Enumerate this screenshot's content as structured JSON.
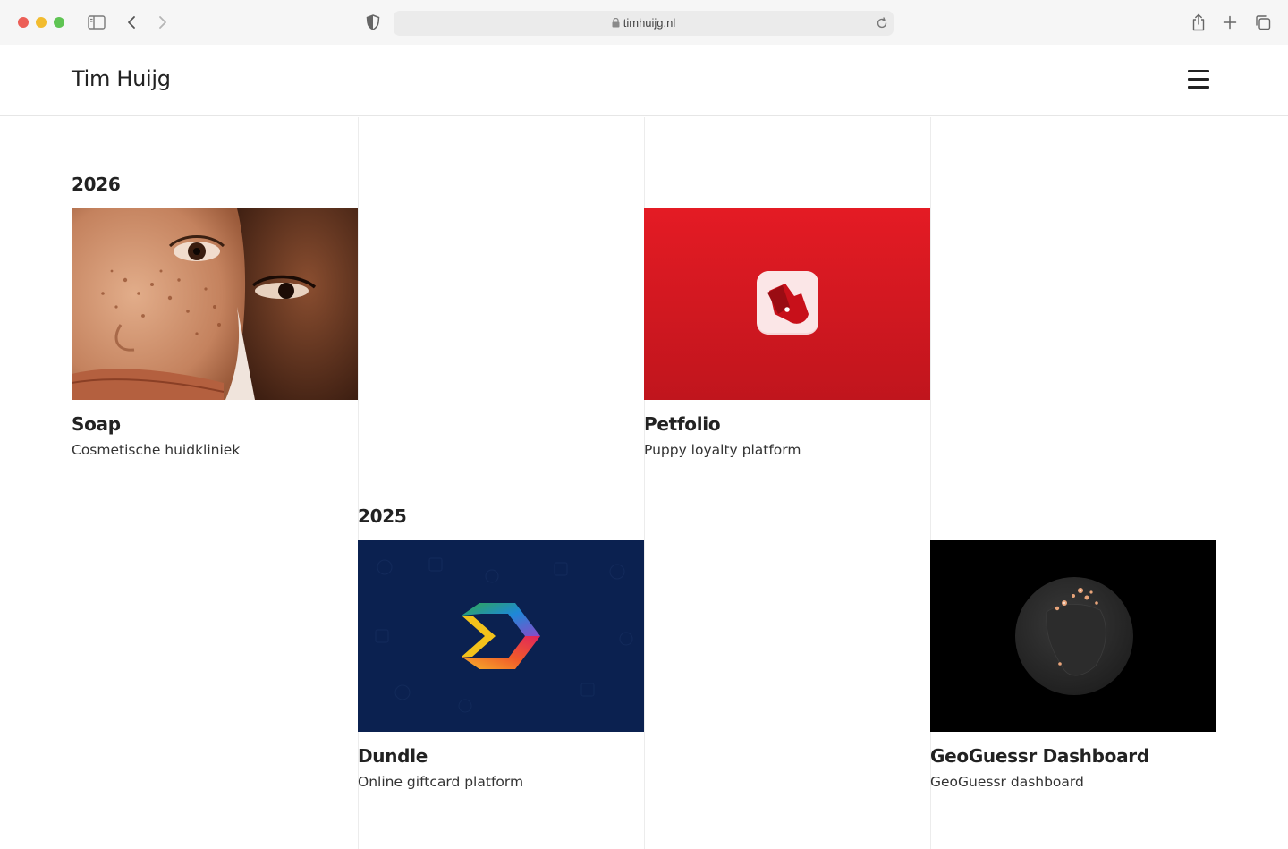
{
  "browser": {
    "url": "timhuijg.nl"
  },
  "site": {
    "title": "Tim Huijg"
  },
  "sections": [
    {
      "year": "2026"
    },
    {
      "year": "2025"
    }
  ],
  "projects": [
    {
      "title": "Soap",
      "subtitle": "Cosmetische huidkliniek"
    },
    {
      "title": "Petfolio",
      "subtitle": "Puppy loyalty platform"
    },
    {
      "title": "Dundle",
      "subtitle": "Online giftcard platform"
    },
    {
      "title": "GeoGuessr Dashboard",
      "subtitle": "GeoGuessr dashboard"
    }
  ],
  "colors": {
    "petfolio_red": "#e41b24",
    "dundle_navy": "#0b2150",
    "geo_black": "#000000"
  }
}
